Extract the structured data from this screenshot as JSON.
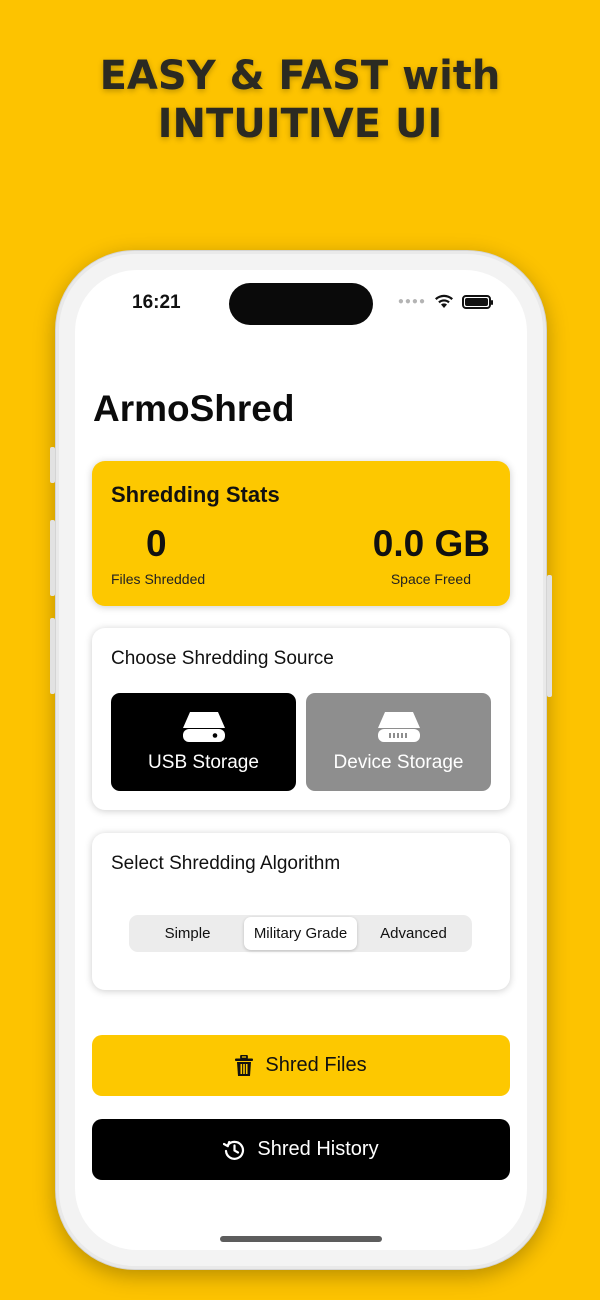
{
  "marketing": {
    "headline_line1": "EASY & FAST with",
    "headline_line2": "INTUITIVE UI"
  },
  "status_bar": {
    "time": "16:21",
    "icons": [
      "signal-dots-icon",
      "wifi-icon",
      "battery-icon"
    ]
  },
  "app": {
    "title": "ArmoShred"
  },
  "stats": {
    "title": "Shredding Stats",
    "files_shredded_value": "0",
    "files_shredded_label": "Files Shredded",
    "space_freed_value": "0.0 GB",
    "space_freed_label": "Space Freed"
  },
  "source": {
    "title": "Choose Shredding Source",
    "options": [
      {
        "label": "USB Storage",
        "icon": "usb-drive-icon",
        "selected": true
      },
      {
        "label": "Device Storage",
        "icon": "device-drive-icon",
        "selected": false
      }
    ]
  },
  "algorithm": {
    "title": "Select Shredding Algorithm",
    "segments": [
      "Simple",
      "Military Grade",
      "Advanced"
    ],
    "selected": "Military Grade"
  },
  "actions": {
    "shred_label": "Shred Files",
    "shred_icon": "trash-icon",
    "history_label": "Shred History",
    "history_icon": "history-icon"
  },
  "colors": {
    "accent": "#FDC800",
    "background": "#FDC300",
    "selected_source": "#000000",
    "unselected_source": "#8e8e8e"
  }
}
